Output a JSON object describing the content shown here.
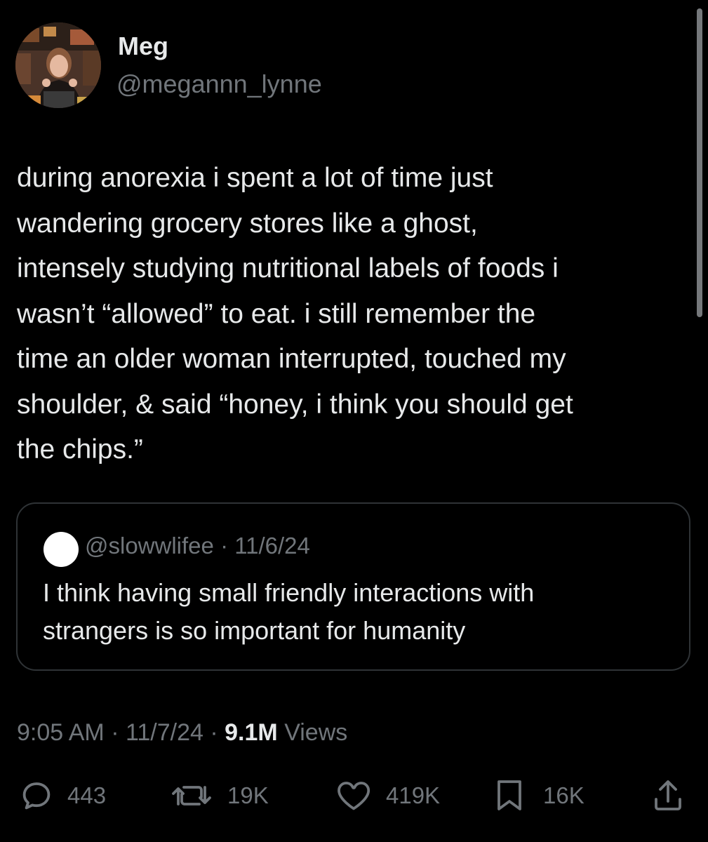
{
  "author": {
    "name": "Meg",
    "handle": "@megannn_lynne",
    "avatar_icon": "profile-photo"
  },
  "tweet": {
    "lines": [
      "during anorexia i spent a lot of time just",
      "wandering grocery stores like a ghost,",
      "intensely studying nutritional labels of foods i",
      "wasn’t “allowed” to eat. i still remember the",
      "time an older woman interrupted, touched my",
      "shoulder, & said “honey, i think you should get",
      "the chips.”"
    ]
  },
  "quote": {
    "handle": "@slowwlifee",
    "separator": "·",
    "date": "11/6/24",
    "lines": [
      "I think having small friendly interactions with",
      "strangers is so important for humanity"
    ]
  },
  "meta": {
    "time": "9:05 AM",
    "sep1": "·",
    "date": "11/7/24",
    "sep2": "·",
    "views_count": "9.1M",
    "views_label": "Views"
  },
  "actions": {
    "reply": {
      "icon": "reply-icon",
      "count": "443"
    },
    "retweet": {
      "icon": "retweet-icon",
      "count": "19K"
    },
    "like": {
      "icon": "heart-icon",
      "count": "419K"
    },
    "bookmark": {
      "icon": "bookmark-icon",
      "count": "16K"
    },
    "share": {
      "icon": "share-icon"
    }
  },
  "colors": {
    "background": "#000000",
    "text_primary": "#e7e9ea",
    "text_secondary": "#71767b",
    "border": "#2f3336"
  }
}
